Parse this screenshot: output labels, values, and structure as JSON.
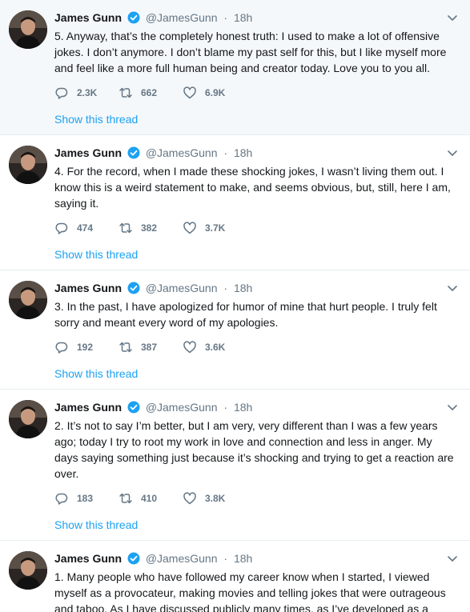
{
  "brand_color": "#1da1f2",
  "tweets": [
    {
      "name": "James Gunn",
      "handle": "@JamesGunn",
      "separator": "·",
      "time": "18h",
      "text": "5. Anyway, that’s the completely honest truth: I used to make a lot of offensive jokes. I don’t anymore. I don’t blame my past self for this, but I like myself more and feel like a more full human being and creator today.  Love you to you all.",
      "replies": "2.3K",
      "retweets": "662",
      "likes": "6.9K",
      "show_thread": "Show this thread"
    },
    {
      "name": "James Gunn",
      "handle": "@JamesGunn",
      "separator": "·",
      "time": "18h",
      "text": "4. For the record, when I made these shocking jokes, I wasn’t living them out. I know this is a weird statement to make, and seems obvious, but, still, here I am, saying it.",
      "replies": "474",
      "retweets": "382",
      "likes": "3.7K",
      "show_thread": "Show this thread"
    },
    {
      "name": "James Gunn",
      "handle": "@JamesGunn",
      "separator": "·",
      "time": "18h",
      "text": "3. In the past, I have apologized for humor of mine that hurt people. I truly felt sorry and meant every word of my apologies.",
      "replies": "192",
      "retweets": "387",
      "likes": "3.6K",
      "show_thread": "Show this thread"
    },
    {
      "name": "James Gunn",
      "handle": "@JamesGunn",
      "separator": "·",
      "time": "18h",
      "text": "2. It’s not to say I’m better, but I am very, very different than I was a few years ago; today I try to root my work in love and connection and less in anger.  My days saying something just because it’s shocking and trying to get a reaction are over.",
      "replies": "183",
      "retweets": "410",
      "likes": "3.8K",
      "show_thread": "Show this thread"
    },
    {
      "name": "James Gunn",
      "handle": "@JamesGunn",
      "separator": "·",
      "time": "18h",
      "text": "1. Many people who have followed my career know when I started, I viewed myself as a provocateur, making movies and telling jokes that were outrageous and taboo. As I have discussed publicly many times, as I’ve developed as a person, so has my work and my humor."
    }
  ]
}
